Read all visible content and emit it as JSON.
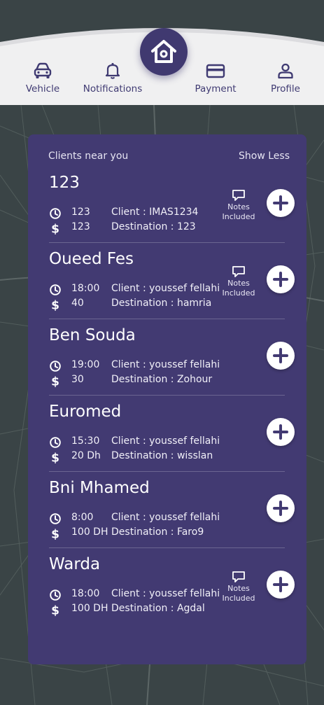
{
  "colors": {
    "primary": "#423a72",
    "nav_text": "#3f3a72",
    "topbar": "#f0f0f1",
    "map_bg": "#3a4446"
  },
  "nav": {
    "items": [
      {
        "label": "Vehicle",
        "icon": "car-icon"
      },
      {
        "label": "Notifications",
        "icon": "bell-icon"
      },
      {
        "label": "Payment",
        "icon": "credit-card-icon"
      },
      {
        "label": "Profile",
        "icon": "user-icon"
      }
    ],
    "home_icon": "home-icon"
  },
  "panel": {
    "title": "Clients near you",
    "toggle_label": "Show Less",
    "notes_label_1": "Notes",
    "notes_label_2": "Included",
    "rides": [
      {
        "name": "123",
        "time": "123",
        "price": "123",
        "client": "Client : IMAS1234",
        "destination": "Destination : 123",
        "notes": true
      },
      {
        "name": "Oueed Fes",
        "time": "18:00",
        "price": "40",
        "client": "Client : youssef fellahi",
        "destination": "Destination : hamria",
        "notes": true
      },
      {
        "name": "Ben Souda",
        "time": "19:00",
        "price": "30",
        "client": "Client : youssef fellahi",
        "destination": "Destination : Zohour",
        "notes": false
      },
      {
        "name": "Euromed",
        "time": "15:30",
        "price": "20 Dh",
        "client": "Client : youssef fellahi",
        "destination": "Destination : wisslan",
        "notes": false
      },
      {
        "name": "Bni Mhamed",
        "time": "8:00",
        "price": "100 DH",
        "client": "Client : youssef fellahi",
        "destination": "Destination : Faro9",
        "notes": false
      },
      {
        "name": "Warda",
        "time": "18:00",
        "price": "100 DH",
        "client": "Client : youssef fellahi",
        "destination": "Destination : Agdal",
        "notes": true
      }
    ]
  }
}
